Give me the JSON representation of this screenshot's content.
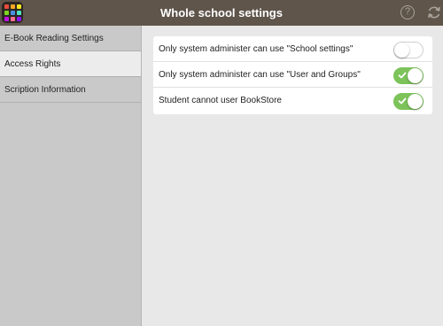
{
  "header": {
    "title": "Whole school settings",
    "help_symbol": "?",
    "icons": [
      "app-grid-icon",
      "help-icon",
      "refresh-icon"
    ]
  },
  "sidebar": {
    "items": [
      {
        "label": "E-Book Reading Settings",
        "active": false
      },
      {
        "label": "Access Rights",
        "active": true
      },
      {
        "label": "Scription Information",
        "active": false
      }
    ]
  },
  "settings": {
    "rows": [
      {
        "label": "Only system administer can use \"School settings\"",
        "enabled": false
      },
      {
        "label": "Only system administer can use \"User and Groups\"",
        "enabled": true
      },
      {
        "label": "Student cannot user BookStore",
        "enabled": true
      }
    ]
  },
  "colors": {
    "header_bg": "#5f554b",
    "toggle_on": "#7cc35a",
    "sidebar_bg": "#c9c9c9",
    "active_item_bg": "#ececec"
  }
}
